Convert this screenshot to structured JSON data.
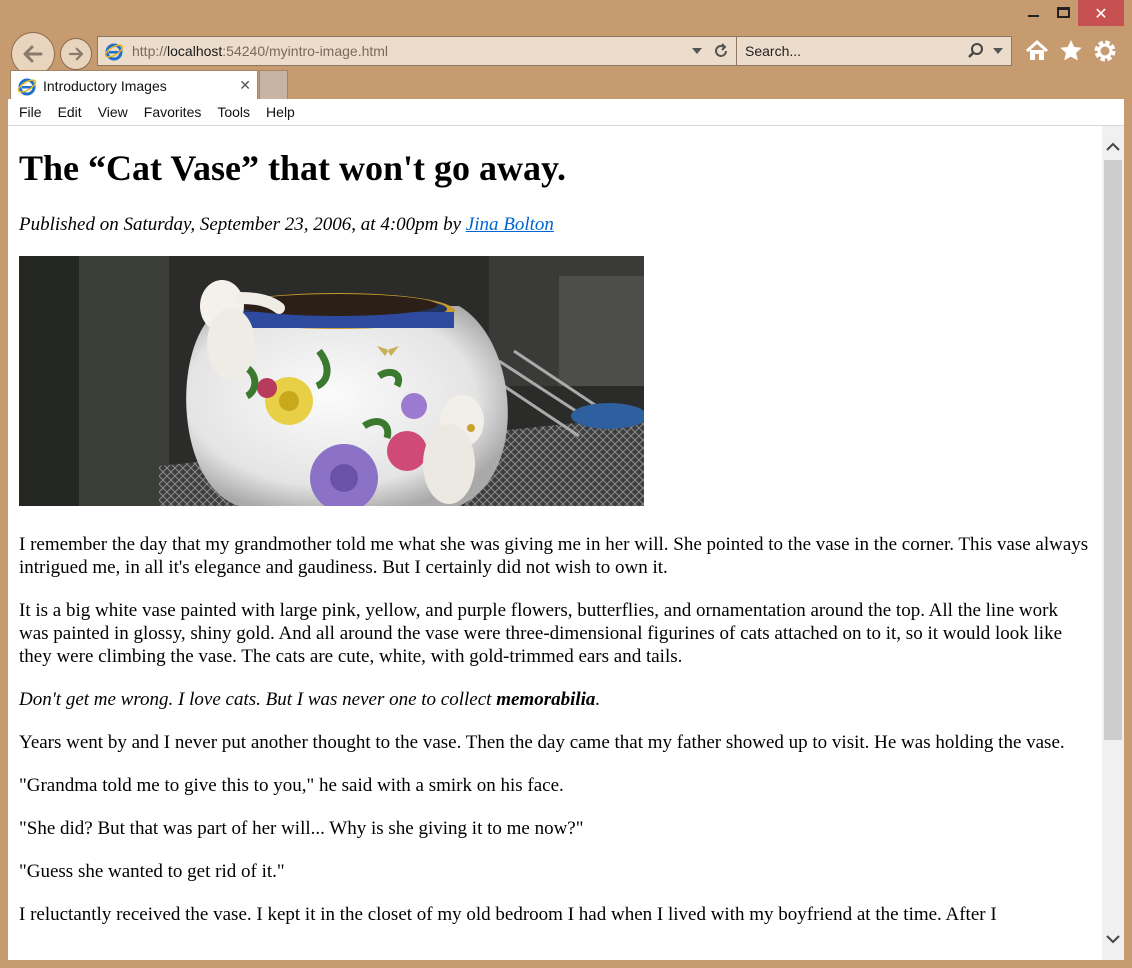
{
  "window": {
    "close_glyph": "✕"
  },
  "nav": {
    "url_prefix": "http://",
    "url_host": "localhost",
    "url_rest": ":54240/myintro-image.html",
    "search_placeholder": "Search..."
  },
  "tab": {
    "label": "Introductory Images",
    "close_glyph": "✕"
  },
  "menu": [
    "File",
    "Edit",
    "View",
    "Favorites",
    "Tools",
    "Help"
  ],
  "article": {
    "title": "The “Cat Vase” that won't go away.",
    "byline_prefix": "Published on Saturday, September 23, 2006, at 4:00pm by ",
    "author": "Jina Bolton",
    "paragraphs": [
      "I remember the day that my grandmother told me what she was giving me in her will. She pointed to the vase in the corner. This vase always intrigued me, in all it's elegance and gaudiness. But I certainly did not wish to own it.",
      "It is a big white vase painted with large pink, yellow, and purple flowers, butterflies, and ornamentation around the top. All the line work was painted in glossy, shiny gold. And all around the vase were three-dimensional figurines of cats attached on to it, so it would look like they were climbing the vase. The cats are cute, white, with gold-trimmed ears and tails."
    ],
    "italic_paragraph_start": "Don't get me wrong. I love cats. But I was never one to collect ",
    "italic_paragraph_bold": "memorabilia",
    "italic_paragraph_end": ".",
    "paragraphs_after": [
      "Years went by and I never put another thought to the vase. Then the day came that my father showed up to visit. He was holding the vase.",
      "\"Grandma told me to give this to you,\" he said with a smirk on his face.",
      "\"She did? But that was part of her will... Why is she giving it to me now?\"",
      "\"Guess she wanted to get rid of it.\"",
      "I reluctantly received the vase. I kept it in the closet of my old bedroom I had when I lived with my boyfriend at the time. After I"
    ]
  },
  "colors": {
    "frame": "#c69b70",
    "close_button": "#c75050",
    "link": "#0066cc",
    "ie_blue": "#1e6fd0"
  }
}
